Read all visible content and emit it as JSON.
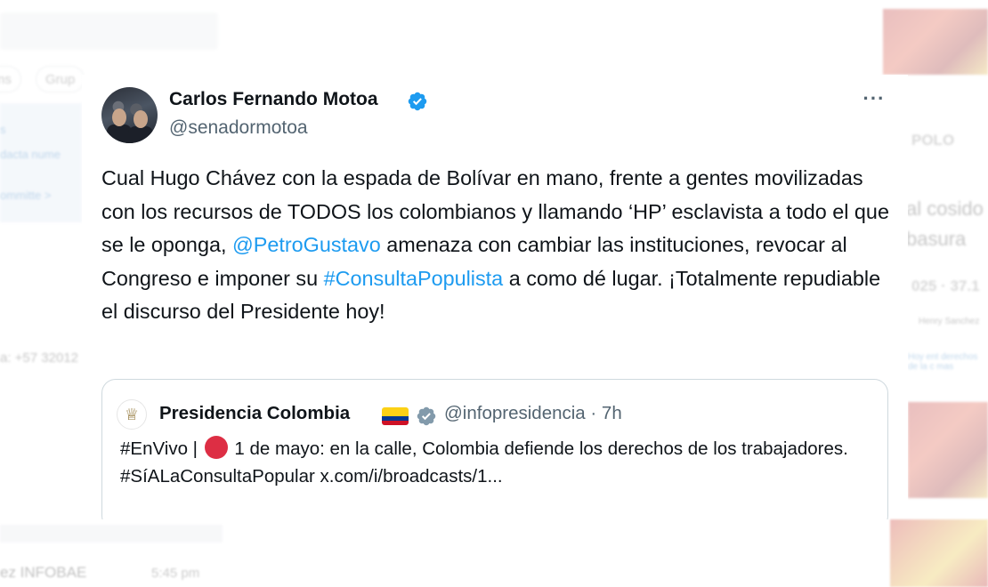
{
  "background": {
    "chips": [
      "ns",
      "Grup"
    ],
    "card_lines": [
      "s",
      "dacta nume",
      "ommitte >"
    ],
    "left_phone": "a: +57 32012",
    "bottom_left": "ez INFOBAE",
    "bottom_time": "5:45 pm",
    "right_name": "POLO",
    "right_text_1": "al cosido",
    "right_text_2": "basura",
    "right_stats": "025 · 37.1",
    "right_small_name": "Henry Sanchez",
    "right_small_text": "Hoy ent derechos de la c mas"
  },
  "tweet": {
    "author_name": "Carlos Fernando Motoa",
    "handle": "@senadormotoa",
    "more": "···",
    "body_part1": "Cual Hugo Chávez con la espada de Bolívar en mano, frente a gentes movilizadas con los recursos de TODOS los colombianos y llamando ‘HP’ esclavista a todo el que se le oponga, ",
    "mention": "@PetroGustavo",
    "body_part2": " amenaza con cambiar las instituciones, revocar al Congreso e imponer su ",
    "hashtag": "#ConsultaPopulista",
    "body_part3": " a como dé lugar. ¡Totalmente repudiable el discurso del Presidente hoy!"
  },
  "quote": {
    "name": "Presidencia Colombia",
    "handle_time": "@infopresidencia · 7h",
    "line1_a": "#EnVivo | ",
    "line1_b": " 1 de mayo: en la calle, Colombia defiende los derechos de los trabajadores.",
    "line2": "#SíALaConsultaPopular x.com/i/broadcasts/1..."
  },
  "colors": {
    "accent": "#1d9bf0",
    "verified_blue": "#1d9bf0",
    "gov_badge_gray": "#829aab",
    "flag": [
      "#fcd116",
      "#003893",
      "#ce1126"
    ]
  }
}
